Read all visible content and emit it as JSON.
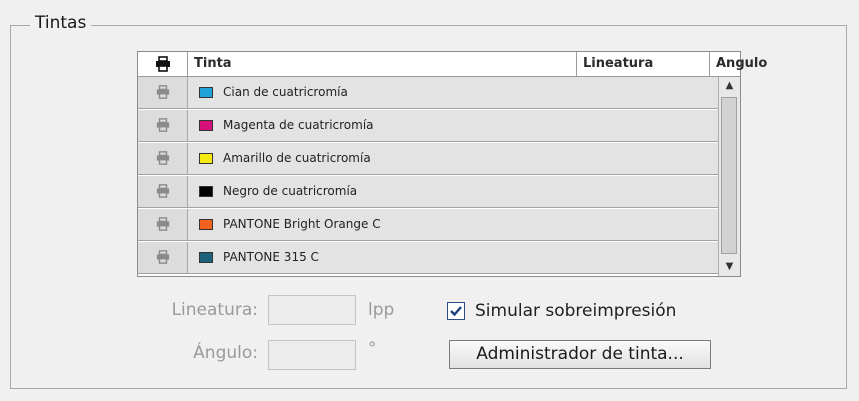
{
  "group": {
    "title": "Tintas"
  },
  "table": {
    "headers": {
      "tinta": "Tinta",
      "lineatura": "Lineatura",
      "angulo": "Angulo"
    },
    "rows": [
      {
        "name": "Cian de cuatricromía",
        "color": "#1fa3d8"
      },
      {
        "name": "Magenta de cuatricromía",
        "color": "#d4107a"
      },
      {
        "name": "Amarillo de cuatricromía",
        "color": "#f4ea10"
      },
      {
        "name": "Negro de cuatricromía",
        "color": "#000000"
      },
      {
        "name": "PANTONE Bright Orange C",
        "color": "#f0621e"
      },
      {
        "name": "PANTONE 315 C",
        "color": "#19627a"
      }
    ]
  },
  "fields": {
    "lineatura_label": "Lineatura:",
    "lineatura_value": "",
    "lineatura_unit": "lpp",
    "angulo_label": "Ángulo:",
    "angulo_value": "",
    "angulo_unit": "°"
  },
  "simulate": {
    "label": "Simular sobreimpresión",
    "checked": true
  },
  "ink_manager_button": "Administrador de tinta..."
}
